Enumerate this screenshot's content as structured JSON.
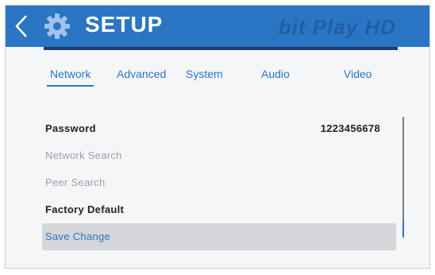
{
  "header": {
    "title": "SETUP",
    "brand": "bit Play HD"
  },
  "tabs": [
    {
      "label": "Network",
      "active": true
    },
    {
      "label": "Advanced",
      "active": false
    },
    {
      "label": "System",
      "active": false
    },
    {
      "label": "Audio",
      "active": false
    },
    {
      "label": "Video",
      "active": false
    }
  ],
  "rows": [
    {
      "label": "Password",
      "value": "1223456678"
    },
    {
      "label": "Network Search"
    },
    {
      "label": "Peer Search"
    },
    {
      "label": "Factory Default"
    },
    {
      "label": "Save Change",
      "selected": true
    }
  ],
  "colors": {
    "header_bg": "#2a75c4",
    "accent": "#2a75c4",
    "selection_bg": "#d4d6d9"
  },
  "icons": {
    "back": "chevron-left-icon",
    "settings": "gear-icon"
  }
}
